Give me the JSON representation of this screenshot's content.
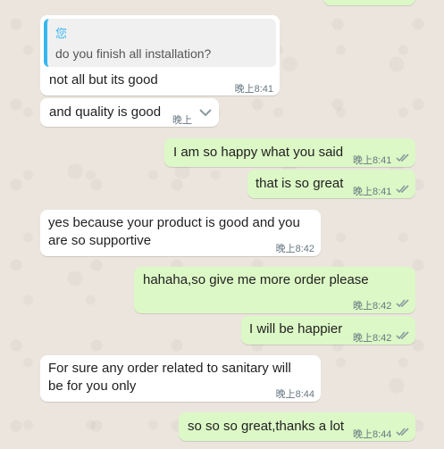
{
  "messages": [
    {
      "quote_author": "您",
      "quote_text": "do you finish all installation?",
      "text": "not all but its good",
      "time": "晚上8:41"
    },
    {
      "text": "and quality is good",
      "time": "晚上"
    },
    {
      "text": "I am so happy what you said",
      "time": "晚上8:41"
    },
    {
      "text": "that is so great",
      "time": "晚上8:41"
    },
    {
      "line1": "yes because your product is good and you",
      "line2": "are so supportive",
      "time": "晚上8:42"
    },
    {
      "text": "hahaha,so give me more order please",
      "time": "晚上8:42"
    },
    {
      "text": "I will be happier",
      "time": "晚上8:42"
    },
    {
      "line1": "For sure any order related to sanitary will",
      "line2": "be for you only",
      "time": "晚上8:44"
    },
    {
      "text": "so so so great,thanks a lot",
      "time": "晚上8:44"
    }
  ],
  "colors": {
    "incoming": "#ffffff",
    "outgoing": "#dcf8c6",
    "quote_accent": "#34b7f1",
    "ticks": "#8a9a9f"
  },
  "icons": {
    "read_ticks": "double-check-icon",
    "menu": "chevron-down-icon"
  }
}
